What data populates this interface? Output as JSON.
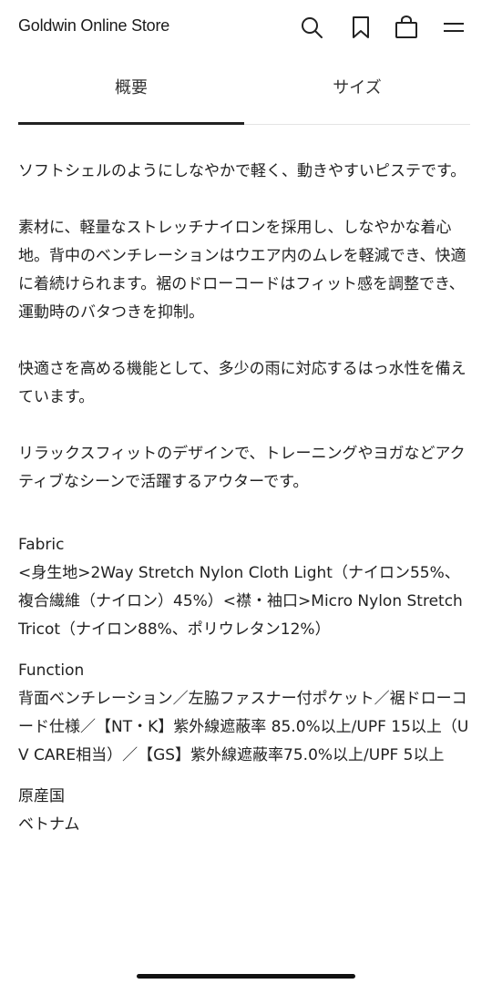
{
  "header": {
    "brand": "Goldwin Online Store",
    "icons": [
      "search-icon",
      "bookmark-icon",
      "bag-icon",
      "menu-icon"
    ]
  },
  "tabs": [
    {
      "label": "概要",
      "active": true
    },
    {
      "label": "サイズ",
      "active": false
    }
  ],
  "description": [
    "ソフトシェルのようにしなやかで軽く、動きやすいピステです。",
    "素材に、軽量なストレッチナイロンを採用し、しなやかな着心地。背中のベンチレーションはウエア内のムレを軽減でき、快適に着続けられます。裾のドローコードはフィット感を調整でき、運動時のバタつきを抑制。",
    "快適さを高める機能として、多少の雨に対応するはっ水性を備えています。",
    "リラックスフィットのデザインで、トレーニングやヨガなどアクティブなシーンで活躍するアウターです。"
  ],
  "specs": {
    "fabric_title": "Fabric",
    "fabric_body": "<身生地>2Way Stretch Nylon Cloth Light（ナイロン55%、複合繊維（ナイロン）45%）<襟・袖口>Micro Nylon Stretch Tricot（ナイロン88%、ポリウレタン12%）",
    "function_title": "Function",
    "function_body": "背面ベンチレーション／左脇ファスナー付ポケット／裾ドローコード仕様／【NT・K】紫外線遮蔽率 85.0%以上/UPF 15以上（UV CARE相当）／【GS】紫外線遮蔽率75.0%以上/UPF 5以上",
    "origin_title": "原産国",
    "origin_body": "ベトナム"
  },
  "colors": {
    "text": "#222222",
    "active_tab_indicator": "#222222",
    "divider": "#e4e4e4"
  }
}
